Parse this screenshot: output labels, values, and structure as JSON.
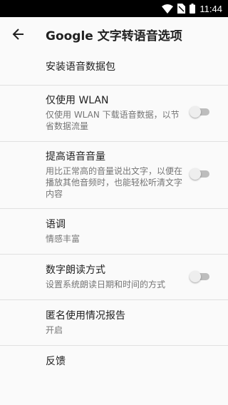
{
  "status_bar": {
    "time": "11:44",
    "icons": [
      "wifi-icon",
      "no-sim-icon",
      "battery-icon"
    ]
  },
  "app_bar": {
    "back_icon": "arrow-back-icon",
    "title": "Google 文字转语音选项"
  },
  "settings": [
    {
      "title": "安装语音数据包"
    },
    {
      "title": "仅使用 WLAN",
      "summary": "仅使用 WLAN 下载语音数据，以节省数据流量",
      "toggle": false
    },
    {
      "title": "提高语音音量",
      "summary": "用比正常高的音量说出文字，以便在播放其他音频时，也能轻松听清文字内容",
      "toggle": false
    },
    {
      "title": "语调",
      "summary": "情感丰富"
    },
    {
      "title": "数字朗读方式",
      "summary": "设置系统朗读日期和时间的方式",
      "toggle": false
    },
    {
      "title": "匿名使用情况报告",
      "summary": "开启"
    },
    {
      "title": "反馈"
    }
  ]
}
